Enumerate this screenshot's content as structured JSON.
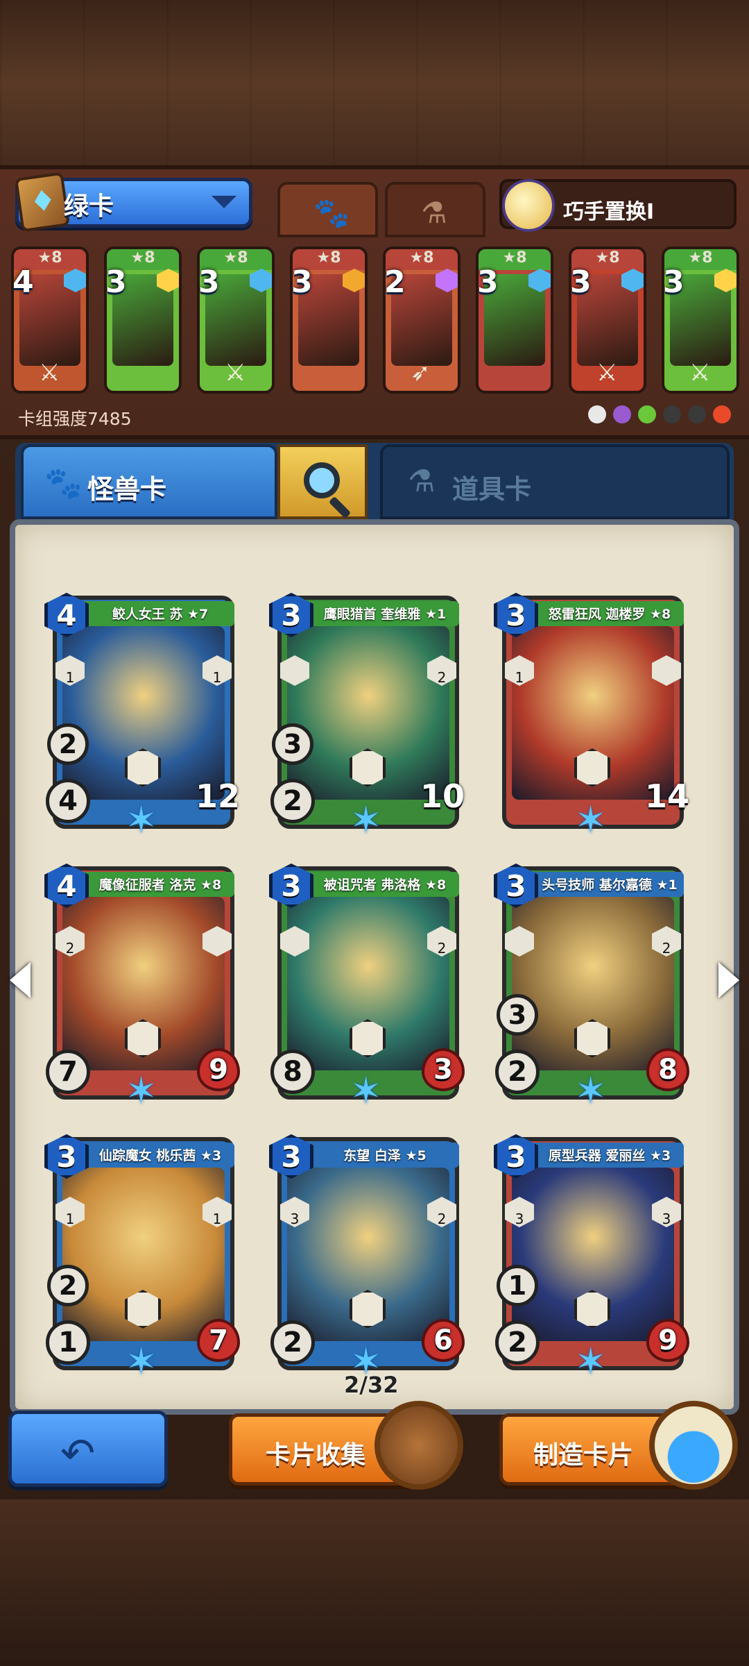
{
  "deck": {
    "name": "绿卡",
    "power_label": "卡组强度7485",
    "swap_label": "巧手置换I",
    "mini_cards": [
      {
        "cost": "4",
        "stars": "★8",
        "band": "#b8453a",
        "body": "#c0562f",
        "gem": "#4fb6f0"
      },
      {
        "cost": "3",
        "stars": "★8",
        "band": "#49a83a",
        "body": "#6cbf3c",
        "gem": "#ffd24a"
      },
      {
        "cost": "3",
        "stars": "★8",
        "band": "#49a83a",
        "body": "#6cbf3c",
        "gem": "#4fb6f0"
      },
      {
        "cost": "3",
        "stars": "★8",
        "band": "#b8453a",
        "body": "#c85f3a",
        "gem": "#f2a72d"
      },
      {
        "cost": "2",
        "stars": "★8",
        "band": "#b8453a",
        "body": "#c85f3a",
        "gem": "#c274ff"
      },
      {
        "cost": "3",
        "stars": "★8",
        "band": "#49a83a",
        "body": "#b8453a",
        "gem": "#4fb6f0"
      },
      {
        "cost": "3",
        "stars": "★8",
        "band": "#b8453a",
        "body": "#c0412c",
        "gem": "#4fb6f0"
      },
      {
        "cost": "3",
        "stars": "★8",
        "band": "#49a83a",
        "body": "#6cbf3c",
        "gem": "#ffd24a"
      }
    ],
    "weapons": [
      "⚔",
      "",
      "⚔",
      "",
      "➶",
      "",
      "⚔",
      "⚔"
    ],
    "element_dots": [
      "#e8e8e8",
      "#9a5ad0",
      "#6ac83a",
      "#3a3a3a",
      "#3a3a3a",
      "#e84a2a"
    ]
  },
  "tabs": {
    "monster": "怪兽卡",
    "item": "道具卡",
    "paw_icon": "🐾",
    "potion_icon": "⚗"
  },
  "cards": [
    {
      "title": "鲛人女王 苏 ★7",
      "cost": "4",
      "atk": "4",
      "hp": "12",
      "shield": "2",
      "hp_style": "plain",
      "frame": "#2a6fb8",
      "art": "#2a5c9a",
      "bar": "#3a9a3a",
      "sides": [
        "1",
        "1"
      ]
    },
    {
      "title": "鹰眼猎首 奎维雅 ★1",
      "cost": "3",
      "atk": "2",
      "hp": "10",
      "shield": "3",
      "hp_style": "plain",
      "frame": "#3a8a3a",
      "art": "#2f7a5a",
      "bar": "#3a9a3a",
      "sides": [
        "",
        "2"
      ]
    },
    {
      "title": "怒雷狂风 迦楼罗 ★8",
      "cost": "3",
      "atk": "",
      "hp": "14",
      "shield": "",
      "hp_style": "plain",
      "frame": "#b8453a",
      "art": "#b03a2a",
      "bar": "#3a9a3a",
      "sides": [
        "1",
        ""
      ]
    },
    {
      "title": "魔像征服者 洛克 ★8",
      "cost": "4",
      "atk": "7",
      "hp": "9",
      "shield": "",
      "hp_style": "heart",
      "frame": "#b8453a",
      "art": "#a34a2a",
      "bar": "#3a9a3a",
      "sides": [
        "2",
        ""
      ]
    },
    {
      "title": "被诅咒者 弗洛格 ★8",
      "cost": "3",
      "atk": "8",
      "hp": "3",
      "shield": "",
      "hp_style": "heart",
      "frame": "#3a8a3a",
      "art": "#2f7a6a",
      "bar": "#3a9a3a",
      "sides": [
        "",
        "2"
      ]
    },
    {
      "title": "头号技师 基尔嘉德 ★1",
      "cost": "3",
      "atk": "2",
      "hp": "8",
      "shield": "3",
      "hp_style": "heart",
      "frame": "#3a8a3a",
      "art": "#8a6a3a",
      "bar": "#2a6fb8",
      "sides": [
        "",
        "2"
      ]
    },
    {
      "title": "仙踪魔女 桃乐茜 ★3",
      "cost": "3",
      "atk": "1",
      "hp": "7",
      "shield": "2",
      "hp_style": "heart",
      "frame": "#2a6fb8",
      "art": "#c88a3a",
      "bar": "#2a6fb8",
      "sides": [
        "1",
        "1"
      ]
    },
    {
      "title": "东望 白泽 ★5",
      "cost": "3",
      "atk": "2",
      "hp": "6",
      "shield": "",
      "hp_style": "heart",
      "frame": "#2a6fb8",
      "art": "#3a6a8a",
      "bar": "#2a6fb8",
      "sides": [
        "3",
        "2"
      ]
    },
    {
      "title": "原型兵器 爱丽丝 ★3",
      "cost": "3",
      "atk": "2",
      "hp": "9",
      "shield": "1",
      "hp_style": "heart",
      "frame": "#b8453a",
      "art": "#2a3a7a",
      "bar": "#2a6fb8",
      "sides": [
        "3",
        "3"
      ]
    }
  ],
  "pager": "2/32",
  "buttons": {
    "collect": "卡片收集",
    "make": "制造卡片",
    "back_icon": "back-arrow-icon"
  }
}
